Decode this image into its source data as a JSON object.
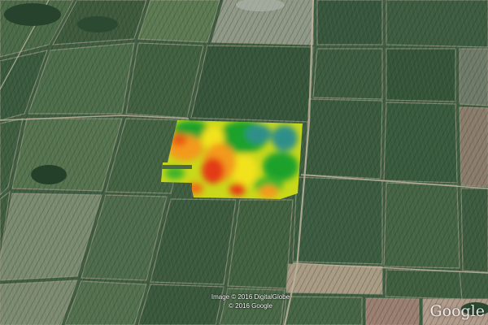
{
  "map": {
    "view": "satellite-oblique",
    "attribution_line1": "Image © 2016 DigitalGlobe",
    "attribution_line2": "© 2016 Google",
    "logo_text": "Google"
  },
  "overlay": {
    "type": "yield-heatmap",
    "palette": {
      "high": "#2e8f8a",
      "good": "#1aa12b",
      "mid": "#9ed419",
      "medium": "#f2e21c",
      "lowish": "#f39a1b",
      "low": "#e33a16"
    }
  },
  "colors": {
    "field_dark": "#34533a",
    "field_mid": "#4a6b47",
    "field_light": "#6a8361",
    "bare_soil": "#a28f7a",
    "road": "#b5ad9a"
  }
}
